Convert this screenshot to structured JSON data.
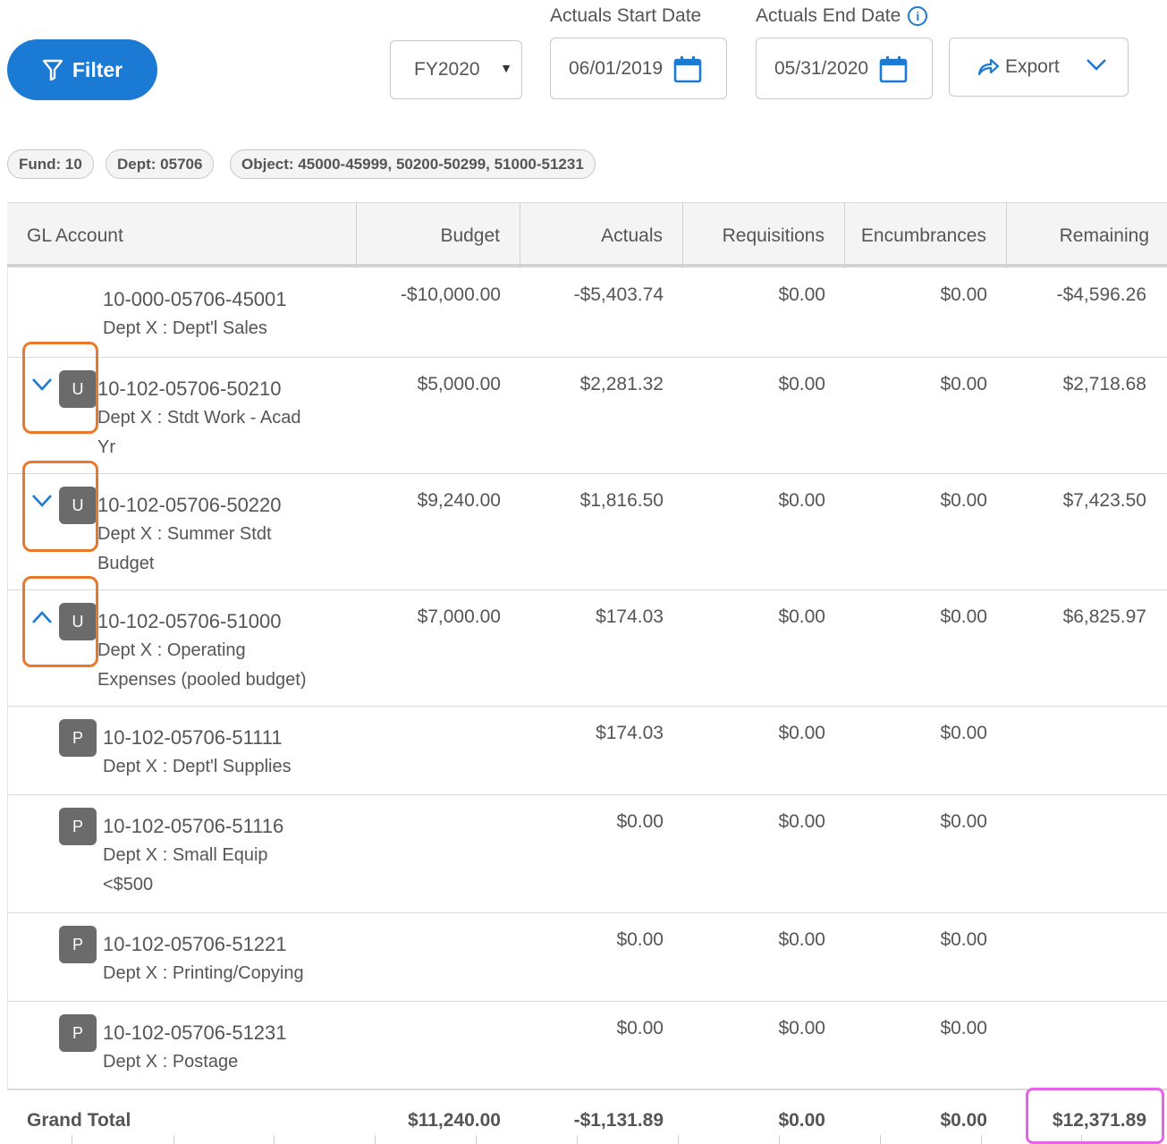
{
  "filter_button": {
    "label": "Filter"
  },
  "fiscal_year": {
    "value": "FY2020"
  },
  "actuals_start": {
    "label": "Actuals Start Date",
    "value": "06/01/2019"
  },
  "actuals_end": {
    "label": "Actuals End Date",
    "value": "05/31/2020"
  },
  "export_button": {
    "label": "Export"
  },
  "chips": [
    "Fund: 10",
    "Dept: 05706",
    "Object: 45000-45999, 50200-50299, 51000-51231"
  ],
  "columns": [
    "GL Account",
    "Budget",
    "Actuals",
    "Requisitions",
    "Encumbrances",
    "Remaining"
  ],
  "rows": [
    {
      "account": "10-000-05706-45001",
      "desc": [
        "Dept X : Dept'l Sales"
      ],
      "badge": "",
      "toggle": "",
      "budget": "-$10,000.00",
      "actuals": "-$5,403.74",
      "requisitions": "$0.00",
      "encumbrances": "$0.00",
      "remaining": "-$4,596.26"
    },
    {
      "account": "10-102-05706-50210",
      "desc": [
        "Dept X : Stdt Work - Acad",
        "Yr"
      ],
      "badge": "U",
      "toggle": "down",
      "budget": "$5,000.00",
      "actuals": "$2,281.32",
      "requisitions": "$0.00",
      "encumbrances": "$0.00",
      "remaining": "$2,718.68"
    },
    {
      "account": "10-102-05706-50220",
      "desc": [
        "Dept X : Summer Stdt",
        "Budget"
      ],
      "badge": "U",
      "toggle": "down",
      "budget": "$9,240.00",
      "actuals": "$1,816.50",
      "requisitions": "$0.00",
      "encumbrances": "$0.00",
      "remaining": "$7,423.50"
    },
    {
      "account": "10-102-05706-51000",
      "desc": [
        "Dept X : Operating",
        "Expenses (pooled budget)"
      ],
      "badge": "U",
      "toggle": "up",
      "budget": "$7,000.00",
      "actuals": "$174.03",
      "requisitions": "$0.00",
      "encumbrances": "$0.00",
      "remaining": "$6,825.97"
    },
    {
      "account": "10-102-05706-51111",
      "desc": [
        "Dept X : Dept'l Supplies"
      ],
      "badge": "P",
      "toggle": "",
      "budget": "",
      "actuals": "$174.03",
      "requisitions": "$0.00",
      "encumbrances": "$0.00",
      "remaining": ""
    },
    {
      "account": "10-102-05706-51116",
      "desc": [
        "Dept X : Small Equip",
        "<$500"
      ],
      "badge": "P",
      "toggle": "",
      "budget": "",
      "actuals": "$0.00",
      "requisitions": "$0.00",
      "encumbrances": "$0.00",
      "remaining": ""
    },
    {
      "account": "10-102-05706-51221",
      "desc": [
        "Dept X : Printing/Copying"
      ],
      "badge": "P",
      "toggle": "",
      "budget": "",
      "actuals": "$0.00",
      "requisitions": "$0.00",
      "encumbrances": "$0.00",
      "remaining": ""
    },
    {
      "account": "10-102-05706-51231",
      "desc": [
        "Dept X : Postage"
      ],
      "badge": "P",
      "toggle": "",
      "budget": "",
      "actuals": "$0.00",
      "requisitions": "$0.00",
      "encumbrances": "$0.00",
      "remaining": ""
    }
  ],
  "grand_total": {
    "label": "Grand Total",
    "budget": "$11,240.00",
    "actuals": "-$1,131.89",
    "requisitions": "$0.00",
    "encumbrances": "$0.00",
    "remaining": "$12,371.89"
  },
  "colors": {
    "primary": "#1b7ad3",
    "highlight_orange": "#e8782b",
    "highlight_pink": "#e762e6",
    "badge": "#6b6b6b"
  }
}
